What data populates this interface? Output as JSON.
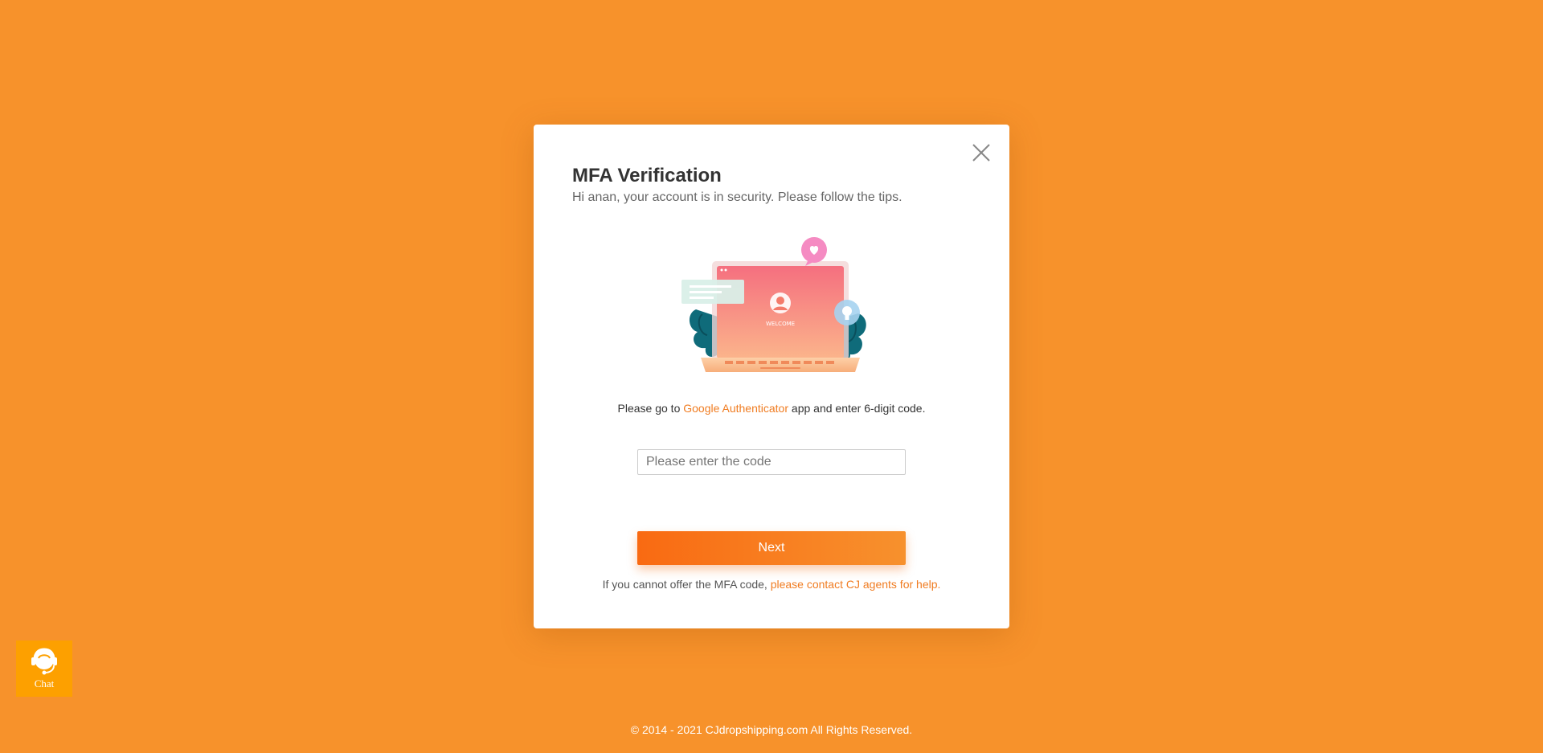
{
  "modal": {
    "title": "MFA Verification",
    "subtitle": "Hi anan, your account is in security. Please follow the tips.",
    "illustration": {
      "icon": "laptop-welcome-illustration",
      "screen_text": "WELCOME"
    },
    "instruction": {
      "prefix": "Please go to ",
      "link": "Google Authenticator",
      "suffix": " app and enter 6-digit code."
    },
    "code_input": {
      "placeholder": "Please enter the code",
      "value": ""
    },
    "next_label": "Next",
    "help": {
      "prefix": "If you cannot offer the MFA code, ",
      "link": "please contact CJ agents for help."
    },
    "close_icon": "close-icon"
  },
  "chat": {
    "label": "Chat",
    "icon": "headset-icon"
  },
  "footer": {
    "copyright": "© 2014 - 2021 CJdropshipping.com All Rights Reserved."
  },
  "colors": {
    "background": "#f7922b",
    "accent": "#f07c21",
    "button_start": "#f96a12",
    "button_end": "#f7912d",
    "chat_bg": "#fda000"
  }
}
